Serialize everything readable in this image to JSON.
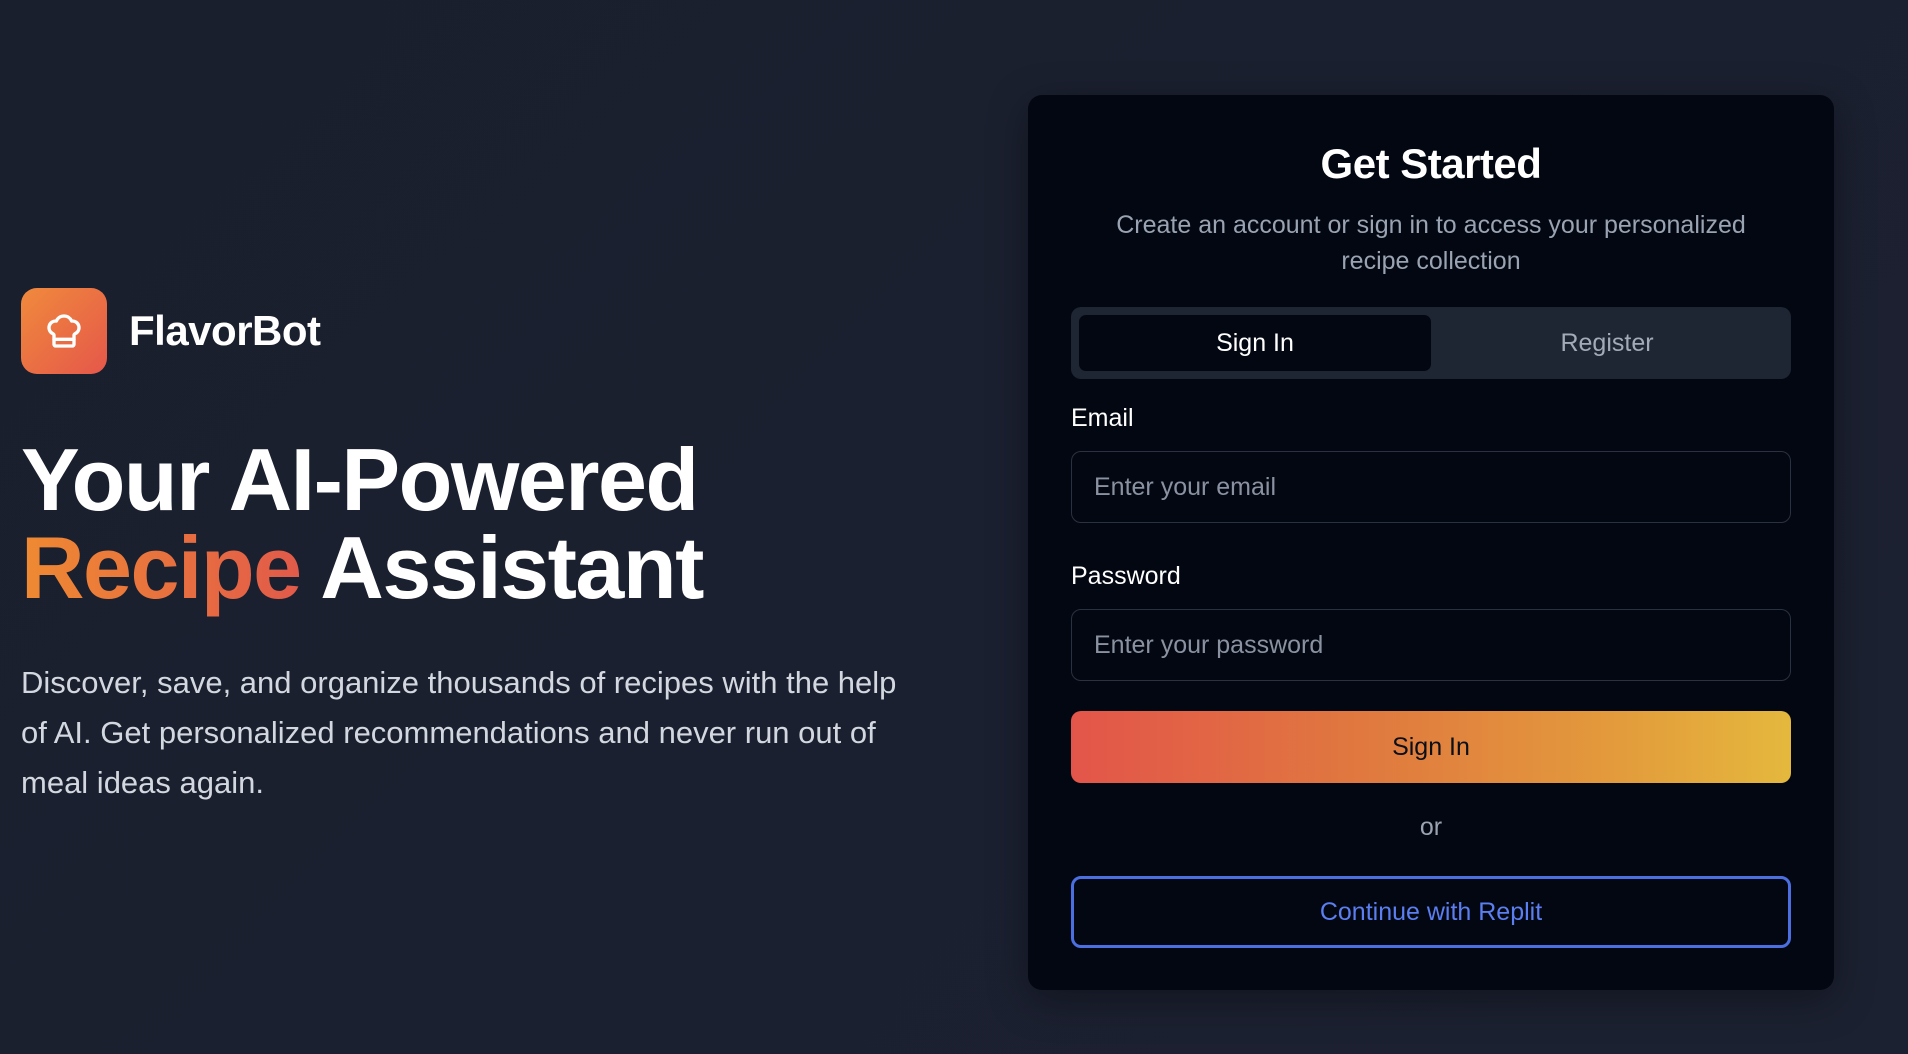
{
  "brand": {
    "name": "FlavorBot",
    "icon": "chef-hat-icon"
  },
  "hero": {
    "headline_line1": "Your AI-Powered",
    "headline_accent": "Recipe",
    "headline_rest": " Assistant",
    "description": "Discover, save, and organize thousands of recipes with the help of AI. Get personalized recommendations and never run out of meal ideas again."
  },
  "auth": {
    "title": "Get Started",
    "subtitle": "Create an account or sign in to access your personalized recipe collection",
    "tabs": [
      {
        "label": "Sign In",
        "active": true
      },
      {
        "label": "Register",
        "active": false
      }
    ],
    "email_label": "Email",
    "email_placeholder": "Enter your email",
    "password_label": "Password",
    "password_placeholder": "Enter your password",
    "submit_label": "Sign In",
    "divider": "or",
    "replit_label": "Continue with Replit"
  },
  "colors": {
    "background": "#1b2030",
    "accent_orange": "#ef8a32",
    "accent_red": "#e15a4a",
    "card": "#030712",
    "replit_blue": "#4b6fe0"
  }
}
